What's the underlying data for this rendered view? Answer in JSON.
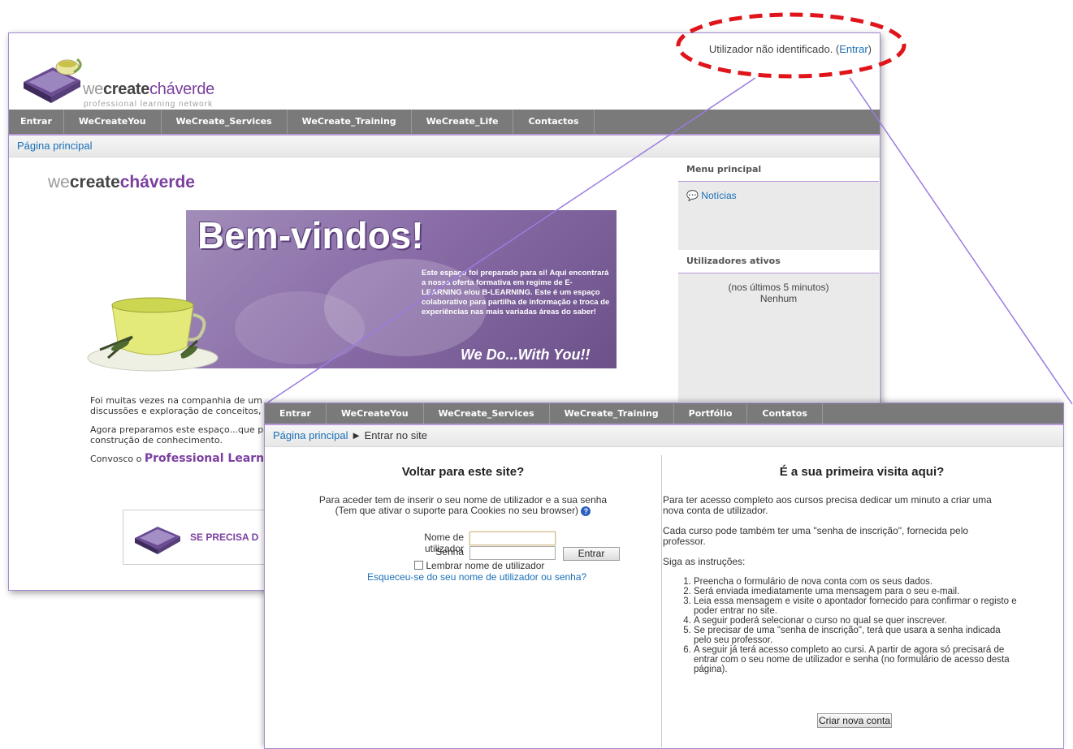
{
  "back": {
    "logo_we": "we",
    "logo_create": "create",
    "logo_chaverde": "cháverde",
    "logo_tagline": "professional learning network",
    "user_info_prefix": "Utilizador não identificado. (",
    "user_info_link": "Entrar",
    "user_info_suffix": ")",
    "nav": [
      "Entrar",
      "WeCreateYou",
      "WeCreate_Services",
      "WeCreate_Training",
      "WeCreate_Life",
      "Contactos"
    ],
    "breadcrumb": "Página principal",
    "site_title_we": "we",
    "site_title_create": "create",
    "site_title_chaverde": "cháverde",
    "banner_title": "Bem-vindos!",
    "banner_text": "Este espaço foi preparado para si! Aqui encontrará a nossa oferta formativa em regime de E-LEARNING e/ou B-LEARNING. Este é um espaço colaborativo para partilha de informação e troca de experiências nas mais variadas áreas do saber!",
    "banner_slogan": "We Do...With You!!",
    "body_p1_l1": "Foi muitas vezes na companhia de um",
    "body_p1_l2": "discussões e exploração de conceitos,",
    "body_p2_l1": "Agora preparamos este espaço...que p",
    "body_p2_l2": "construção de conhecimento.",
    "body_p3_prefix": "Convosco o ",
    "body_p3_bold": "Professional Learning",
    "promo_text": "SE PRECISA D",
    "side_menu_title": "Menu principal",
    "side_menu_item": "Notícias",
    "side_users_title": "Utilizadores ativos",
    "side_users_line1": "(nos últimos 5 minutos)",
    "side_users_line2": "Nenhum"
  },
  "front": {
    "nav": [
      "Entrar",
      "WeCreateYou",
      "WeCreate_Services",
      "WeCreate_Training",
      "Portfólio",
      "Contatos"
    ],
    "breadcrumb_home": "Página principal",
    "breadcrumb_sep": "►",
    "breadcrumb_current": "Entrar no site",
    "left_title": "Voltar para este site?",
    "left_info_l1": "Para aceder tem de inserir o seu nome de utilizador e a sua senha",
    "left_info_l2": "(Tem que ativar o suporte para Cookies no seu browser)",
    "username_label": "Nome de utilizador",
    "password_label": "Senha",
    "login_button": "Entrar",
    "remember_label": "Lembrar nome de utilizador",
    "forgot_link": "Esqueceu-se do seu nome de utilizador ou senha?",
    "right_title": "É a sua primeira visita aqui?",
    "right_p1": "Para ter acesso completo aos cursos precisa dedicar um minuto a criar uma nova conta de utilizador.",
    "right_p2": "Cada curso pode também ter uma \"senha de inscrição\", fornecida pelo professor.",
    "right_p3": "Siga as instruções:",
    "steps": [
      "Preencha o formulário de nova conta com os seus dados.",
      "Será enviada imediatamente uma mensagem para o seu e-mail.",
      "Leia essa mensagem e visite o apontador fornecido para confirmar o registo e poder entrar no site.",
      "A seguir poderá selecionar o curso no qual se quer inscrever.",
      "Se precisar de uma \"senha de inscrição\", terá que usara a senha indicada pelo seu professor.",
      "A seguir já terá acesso completo ao cursi. A partir de agora só precisará de entrar com o seu nome de utilizador e senha (no formulário de acesso desta página)."
    ],
    "create_account_button": "Criar nova conta"
  },
  "colors": {
    "accent_purple": "#7b3fa0",
    "link_blue": "#1a6fb8",
    "nav_gray": "#7a7a7a",
    "highlight_red": "#e0141b"
  }
}
